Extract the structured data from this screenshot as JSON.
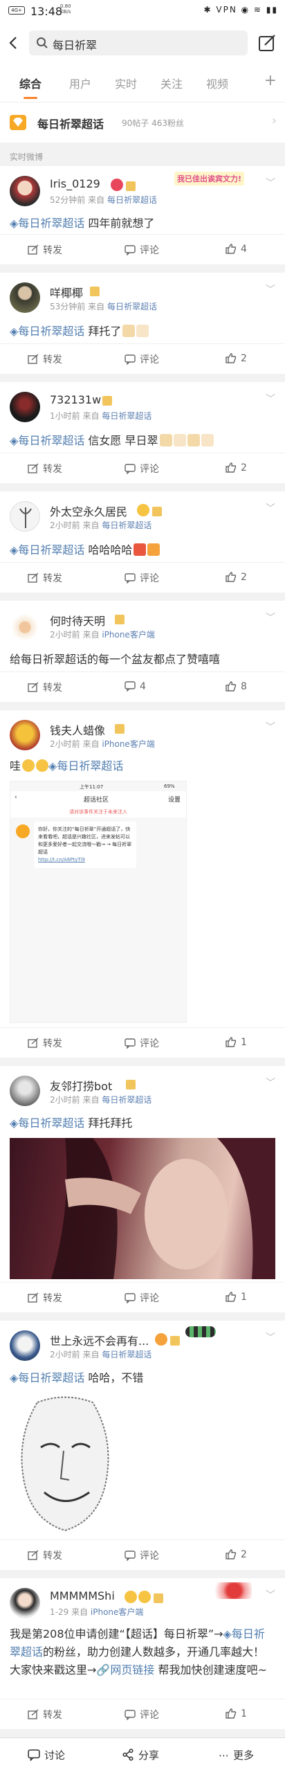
{
  "status_bar": {
    "time": "13:48",
    "net_speed_top": "0.80",
    "net_speed_bottom": "KB/s",
    "signal": "4G+",
    "right_icons": "✱ VPN ◉ ≋ ▮▮"
  },
  "search": {
    "query": "每日祈翠",
    "back_icon": "back-arrow-icon",
    "edit_icon": "compose-icon"
  },
  "tabs": [
    {
      "label": "综合",
      "active": true
    },
    {
      "label": "用户"
    },
    {
      "label": "实时"
    },
    {
      "label": "关注"
    },
    {
      "label": "视频"
    }
  ],
  "tabs_more": "+",
  "super_topic": {
    "name": "每日祈翠超话",
    "stats": "90帖子  463粉丝"
  },
  "section_label": "实时微博",
  "accent_color": "#f7832a",
  "link_color": "#507daf",
  "posts": [
    {
      "user": "Iris_0129",
      "time": "52分钟前",
      "from": "来自",
      "source": "每日祈翠超话",
      "topic": "每日祈翠超话",
      "text": "四年前就想了",
      "forward": "转发",
      "comment": "评论",
      "likes": "4",
      "banner": "我已佳出诶宾文力!"
    },
    {
      "user": "咩椰椰",
      "time": "53分钟前",
      "from": "来自",
      "source": "每日祈翠超话",
      "topic": "每日祈翠超话",
      "text": "拜托了",
      "forward": "转发",
      "comment": "评论",
      "likes": "2"
    },
    {
      "user": "732131w",
      "time": "1小时前",
      "from": "来自",
      "source": "每日祈翠超话",
      "topic": "每日祈翠超话",
      "text": "信女愿 早日翠",
      "forward": "转发",
      "comment": "评论",
      "likes": "2"
    },
    {
      "user": "外太空永久居民",
      "time": "2小时前",
      "from": "来自",
      "source": "每日祈翠超话",
      "topic": "每日祈翠超话",
      "text": "哈哈哈哈",
      "forward": "转发",
      "comment": "评论",
      "likes": "2"
    },
    {
      "user": "何时待天明",
      "time": "2小时前",
      "from": "来自",
      "source": "iPhone客户端",
      "text": "给每日祈翠超话的每一个盆友都点了赞嘻嘻",
      "forward": "转发",
      "comment": "4",
      "likes": "8"
    },
    {
      "user": "钱夫人蜡像",
      "time": "2小时前",
      "from": "来自",
      "source": "iPhone客户端",
      "prefix": "哇",
      "topic": "每日祈翠超话",
      "forward": "转发",
      "comment": "评论",
      "likes": "1",
      "screenshot": {
        "time": "上午11:07",
        "battery": "69%",
        "title": "超话社区",
        "right": "设置",
        "notice": "请对该事件关注于未来注入",
        "message": "你好，你关注的“每日祈翠”开通超话了，快来看看吧，超话是兴趣社区，进来发帖可以和更多爱好者一起交流哦～戳→ → 每日祈翠超话",
        "link": "http://t.cn/A6PtyTi9"
      }
    },
    {
      "user": "友邻打捞bot",
      "time": "2小时前",
      "from": "来自",
      "source": "每日祈翠超话",
      "topic": "每日祈翠超话",
      "text": "拜托拜托",
      "forward": "转发",
      "comment": "评论",
      "likes": "1"
    },
    {
      "user": "世上永远不会再有...",
      "time": "2小时前",
      "from": "来自",
      "source": "每日祈翠超话",
      "topic": "每日祈翠超话",
      "text": "哈哈，不错",
      "forward": "转发",
      "comment": "评论",
      "likes": "2"
    },
    {
      "user": "MMMMMShi",
      "time": "1-29",
      "from": "来自",
      "source": "iPhone客户端",
      "text_before": "我是第208位申请创建“【超话】每日祈翠”→",
      "topic": "每日祈翠超话",
      "text_after": "的粉丝，助力创建人数越多，开通几率越大！大家快来戳这里→",
      "link": "网页链接",
      "text_end": "帮我加快创建速度吧~",
      "forward": "转发",
      "comment": "评论",
      "likes": "1"
    }
  ],
  "bottom_bar": {
    "comment": "讨论",
    "share": "分享",
    "more": "更多"
  }
}
